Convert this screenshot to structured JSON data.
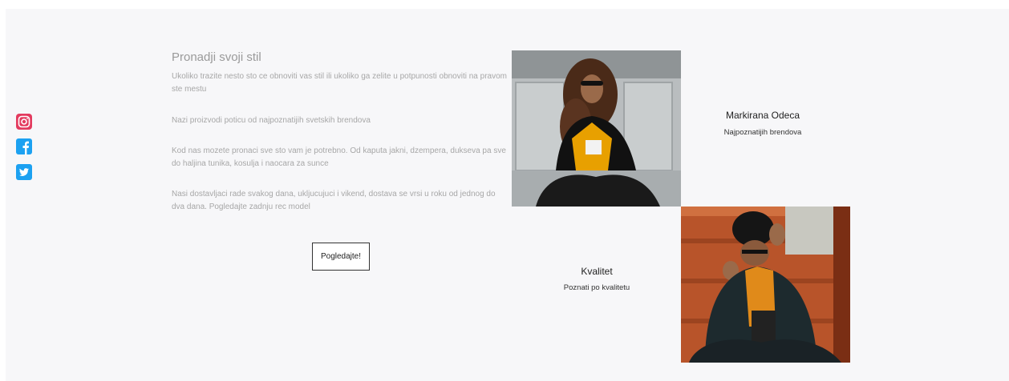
{
  "social": [
    {
      "icon": "instagram-icon",
      "color": "#e1306c"
    },
    {
      "icon": "facebook-icon",
      "color": "#1ca1f1"
    },
    {
      "icon": "twitter-icon",
      "color": "#1ca1f1"
    }
  ],
  "intro": {
    "title": "Pronadji svoji stil",
    "paragraphs": [
      "Ukoliko trazite nesto sto ce obnoviti vas stil ili ukoliko ga zelite u potpunosti obnoviti na pravom ste mestu",
      "Nazi proizvodi poticu od najpoznatijih svetskih brendova",
      "Kod nas mozete pronaci sve sto vam je potrebno. Od kaputa jakni, dzempera, dukseva pa sve do haljina tunika, kosulja i naocara za sunce",
      "Nasi dostavljaci rade svakog dana, ukljucujuci i vikend, dostava se vrsi u roku od jednog do dva dana. Pogledajte zadnju rec model"
    ],
    "button_label": "Pogledajte!"
  },
  "features": [
    {
      "title": "Markirana Odeca",
      "subtitle": "Najpoznatijih brendova"
    },
    {
      "title": "Kvalitet",
      "subtitle": "Poznati po kvalitetu"
    }
  ]
}
